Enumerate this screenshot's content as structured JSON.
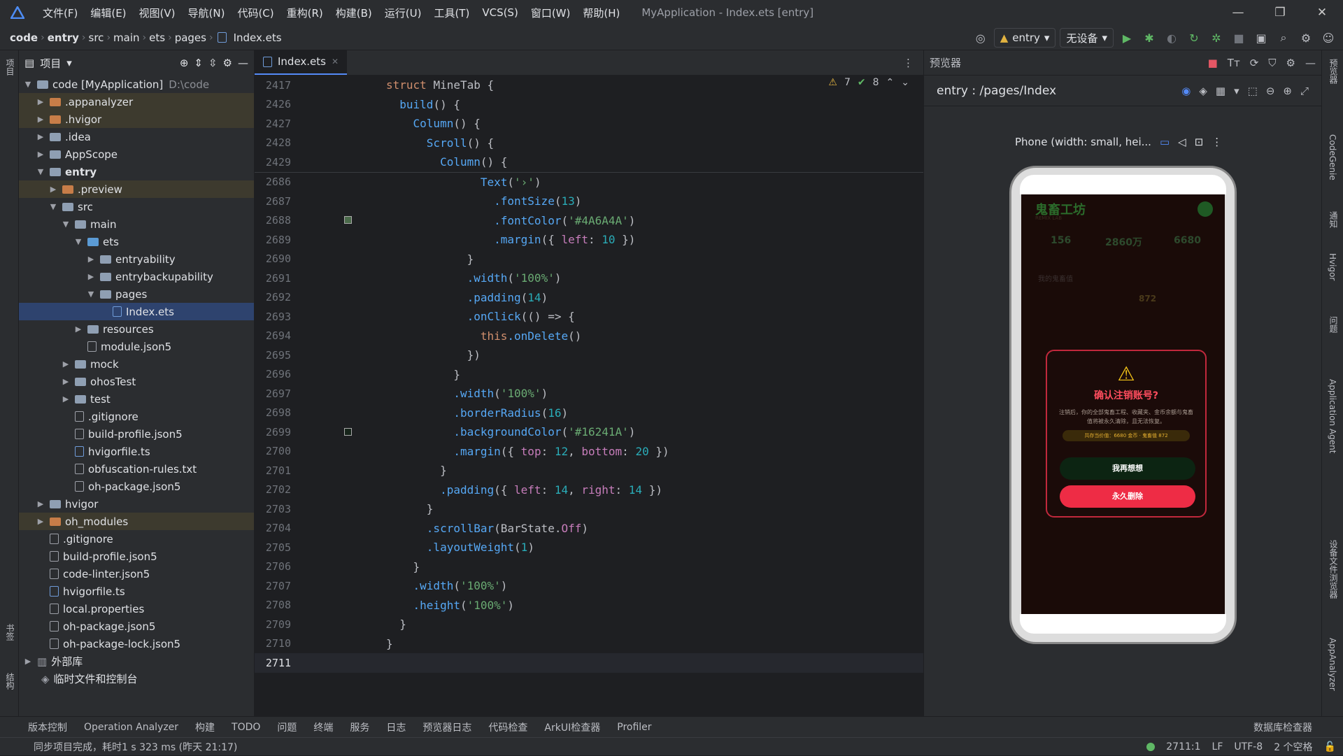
{
  "menubar": {
    "items": [
      "文件(F)",
      "编辑(E)",
      "视图(V)",
      "导航(N)",
      "代码(C)",
      "重构(R)",
      "构建(B)",
      "运行(U)",
      "工具(T)",
      "VCS(S)",
      "窗口(W)",
      "帮助(H)"
    ],
    "title": "MyApplication - Index.ets [entry]"
  },
  "breadcrumb": [
    "code",
    "entry",
    "src",
    "main",
    "ets",
    "pages",
    "Index.ets"
  ],
  "runbar": {
    "module": "entry",
    "device": "无设备"
  },
  "project": {
    "title": "项目",
    "root_label": "code [MyApplication]",
    "root_path": "D:\\code",
    "rows": [
      ".appanalyzer",
      ".hvigor",
      ".idea",
      "AppScope",
      "entry",
      ".preview",
      "src",
      "main",
      "ets",
      "entryability",
      "entrybackupability",
      "pages",
      "Index.ets",
      "resources",
      "module.json5",
      "mock",
      "ohosTest",
      "test",
      ".gitignore",
      "build-profile.json5",
      "hvigorfile.ts",
      "obfuscation-rules.txt",
      "oh-package.json5",
      "hvigor",
      "oh_modules",
      ".gitignore",
      "build-profile.json5",
      "code-linter.json5",
      "hvigorfile.ts",
      "local.properties",
      "oh-package.json5",
      "oh-package-lock.json5",
      "外部库",
      "临时文件和控制台"
    ]
  },
  "editor": {
    "tab": "Index.ets",
    "warnings": "7",
    "checks": "8",
    "sticky": [
      {
        "n": "2417",
        "t": "struct MineTab {"
      },
      {
        "n": "2426",
        "t": "  build() {"
      },
      {
        "n": "2427",
        "t": "    Column() {"
      },
      {
        "n": "2428",
        "t": "      Scroll() {"
      },
      {
        "n": "2429",
        "t": "        Column() {"
      }
    ],
    "lines": [
      {
        "n": "2686",
        "t": "              Text('›')"
      },
      {
        "n": "2687",
        "t": "                .fontSize(13)"
      },
      {
        "n": "2688",
        "t": "                .fontColor('#4A6A4A')"
      },
      {
        "n": "2689",
        "t": "                .margin({ left: 10 })"
      },
      {
        "n": "2690",
        "t": "            }"
      },
      {
        "n": "2691",
        "t": "            .width('100%')"
      },
      {
        "n": "2692",
        "t": "            .padding(14)"
      },
      {
        "n": "2693",
        "t": "            .onClick(() => {"
      },
      {
        "n": "2694",
        "t": "              this.onDelete()"
      },
      {
        "n": "2695",
        "t": "            })"
      },
      {
        "n": "2696",
        "t": "          }"
      },
      {
        "n": "2697",
        "t": "          .width('100%')"
      },
      {
        "n": "2698",
        "t": "          .borderRadius(16)"
      },
      {
        "n": "2699",
        "t": "          .backgroundColor('#16241A')"
      },
      {
        "n": "2700",
        "t": "          .margin({ top: 12, bottom: 20 })"
      },
      {
        "n": "2701",
        "t": "        }"
      },
      {
        "n": "2702",
        "t": "        .padding({ left: 14, right: 14 })"
      },
      {
        "n": "2703",
        "t": "      }"
      },
      {
        "n": "2704",
        "t": "      .scrollBar(BarState.Off)"
      },
      {
        "n": "2705",
        "t": "      .layoutWeight(1)"
      },
      {
        "n": "2706",
        "t": "    }"
      },
      {
        "n": "2707",
        "t": "    .width('100%')"
      },
      {
        "n": "2708",
        "t": "    .height('100%')"
      },
      {
        "n": "2709",
        "t": "  }"
      },
      {
        "n": "2710",
        "t": "}"
      },
      {
        "n": "2711",
        "t": ""
      }
    ]
  },
  "preview": {
    "title": "预览器",
    "route": "entry : /pages/Index",
    "device_label": "Phone (width: small, hei...",
    "app": {
      "brand": "鬼畜工坊",
      "sub": "REMIX LAB",
      "stat1": "156",
      "stat2": "2860万",
      "stat3": "6680",
      "section": "我的鬼畜值",
      "value": "872",
      "dialog_title": "确认注销账号?",
      "dialog_text": "注销后，你的全部鬼畜工程、收藏夹、金币余额与鬼畜值将被永久清除，且无法恢复。",
      "dialog_tag": "共存当价值：6680 金币 · 鬼畜值 872",
      "btn_cancel": "我再想想",
      "btn_delete": "永久删除"
    }
  },
  "bottom": {
    "items": [
      "版本控制",
      "Operation Analyzer",
      "构建",
      "TODO",
      "问题",
      "终端",
      "服务",
      "日志",
      "预览器日志",
      "代码检查",
      "ArkUI检查器",
      "Profiler"
    ],
    "right": "数据库检查器"
  },
  "status": {
    "message": "同步项目完成，耗时1 s 323 ms (昨天 21:17)",
    "pos": "2711:1",
    "lf": "LF",
    "enc": "UTF-8",
    "indent": "2 个空格"
  },
  "leftstrip": {
    "top": "项目",
    "mid": "书签",
    "bot": "结构"
  },
  "rightstrip": [
    "预览器",
    "CodeGenie",
    "通知",
    "Hvigor",
    "问题",
    "Application Agent",
    "设备文件浏览器",
    "AppAnalyzer"
  ]
}
